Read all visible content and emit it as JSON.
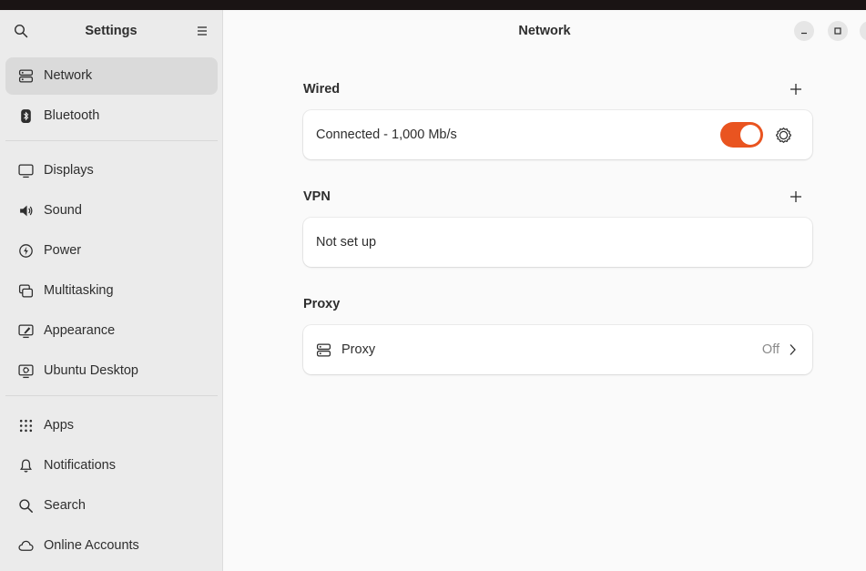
{
  "sidebar": {
    "title": "Settings",
    "groups": [
      [
        {
          "label": "Network",
          "icon": "network-icon",
          "active": true
        },
        {
          "label": "Bluetooth",
          "icon": "bluetooth-icon"
        }
      ],
      [
        {
          "label": "Displays",
          "icon": "display-icon"
        },
        {
          "label": "Sound",
          "icon": "speaker-icon"
        },
        {
          "label": "Power",
          "icon": "power-icon"
        },
        {
          "label": "Multitasking",
          "icon": "multitasking-icon"
        },
        {
          "label": "Appearance",
          "icon": "appearance-icon"
        },
        {
          "label": "Ubuntu Desktop",
          "icon": "ubuntu-desktop-icon"
        }
      ],
      [
        {
          "label": "Apps",
          "icon": "apps-grid-icon"
        },
        {
          "label": "Notifications",
          "icon": "bell-icon"
        },
        {
          "label": "Search",
          "icon": "search-icon"
        },
        {
          "label": "Online Accounts",
          "icon": "cloud-icon"
        }
      ]
    ]
  },
  "main": {
    "title": "Network",
    "wired": {
      "heading": "Wired",
      "status": "Connected - 1,000 Mb/s",
      "enabled": true
    },
    "vpn": {
      "heading": "VPN",
      "status": "Not set up"
    },
    "proxy": {
      "heading": "Proxy",
      "label": "Proxy",
      "value": "Off"
    }
  },
  "colors": {
    "accent": "#e95420",
    "sidebar_bg": "#ebebeb",
    "content_bg": "#fafafa",
    "active_item": "#dadada"
  }
}
